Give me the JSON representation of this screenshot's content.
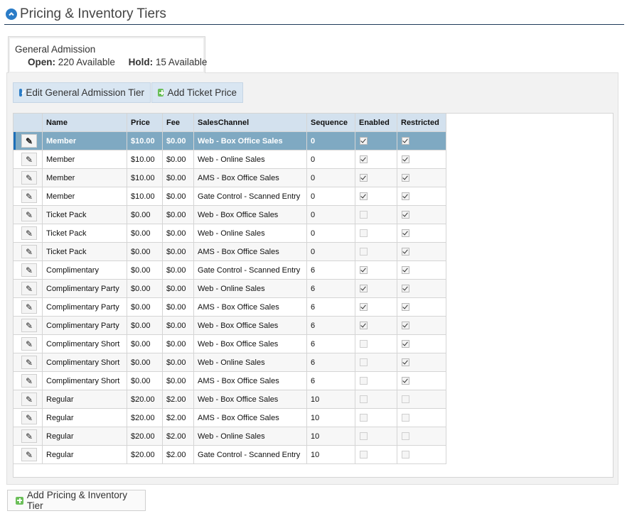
{
  "header": {
    "title": "Pricing & Inventory Tiers",
    "icon": "chevron-up-circle-icon"
  },
  "tier_tab": {
    "name": "General Admission",
    "open_label": "Open:",
    "open_value": "220 Available",
    "hold_label": "Hold:",
    "hold_value": "15 Available"
  },
  "toolbar": {
    "edit_label": "Edit General Admission Tier",
    "add_label": "Add Ticket Price"
  },
  "table": {
    "headers": [
      "Name",
      "Price",
      "Fee",
      "SalesChannel",
      "Sequence",
      "Enabled",
      "Restricted"
    ],
    "rows": [
      {
        "name": "Member",
        "price": "$10.00",
        "fee": "$0.00",
        "channel": "Web - Box Office Sales",
        "sequence": "0",
        "enabled": true,
        "restricted": true,
        "selected": true
      },
      {
        "name": "Member",
        "price": "$10.00",
        "fee": "$0.00",
        "channel": "Web - Online Sales",
        "sequence": "0",
        "enabled": true,
        "restricted": true
      },
      {
        "name": "Member",
        "price": "$10.00",
        "fee": "$0.00",
        "channel": "AMS - Box Office Sales",
        "sequence": "0",
        "enabled": true,
        "restricted": true
      },
      {
        "name": "Member",
        "price": "$10.00",
        "fee": "$0.00",
        "channel": "Gate Control - Scanned Entry",
        "sequence": "0",
        "enabled": true,
        "restricted": true
      },
      {
        "name": "Ticket Pack",
        "price": "$0.00",
        "fee": "$0.00",
        "channel": "Web - Box Office Sales",
        "sequence": "0",
        "enabled": false,
        "restricted": true
      },
      {
        "name": "Ticket Pack",
        "price": "$0.00",
        "fee": "$0.00",
        "channel": "Web - Online Sales",
        "sequence": "0",
        "enabled": false,
        "restricted": true
      },
      {
        "name": "Ticket Pack",
        "price": "$0.00",
        "fee": "$0.00",
        "channel": "AMS - Box Office Sales",
        "sequence": "0",
        "enabled": false,
        "restricted": true
      },
      {
        "name": "Complimentary",
        "price": "$0.00",
        "fee": "$0.00",
        "channel": "Gate Control - Scanned Entry",
        "sequence": "6",
        "enabled": true,
        "restricted": true
      },
      {
        "name": "Complimentary Party",
        "price": "$0.00",
        "fee": "$0.00",
        "channel": "Web - Online Sales",
        "sequence": "6",
        "enabled": true,
        "restricted": true
      },
      {
        "name": "Complimentary Party",
        "price": "$0.00",
        "fee": "$0.00",
        "channel": "AMS - Box Office Sales",
        "sequence": "6",
        "enabled": true,
        "restricted": true
      },
      {
        "name": "Complimentary Party",
        "price": "$0.00",
        "fee": "$0.00",
        "channel": "Web - Box Office Sales",
        "sequence": "6",
        "enabled": true,
        "restricted": true
      },
      {
        "name": "Complimentary Short",
        "price": "$0.00",
        "fee": "$0.00",
        "channel": "Web - Box Office Sales",
        "sequence": "6",
        "enabled": false,
        "restricted": true
      },
      {
        "name": "Complimentary Short",
        "price": "$0.00",
        "fee": "$0.00",
        "channel": "Web - Online Sales",
        "sequence": "6",
        "enabled": false,
        "restricted": true
      },
      {
        "name": "Complimentary Short",
        "price": "$0.00",
        "fee": "$0.00",
        "channel": "AMS - Box Office Sales",
        "sequence": "6",
        "enabled": false,
        "restricted": true
      },
      {
        "name": "Regular",
        "price": "$20.00",
        "fee": "$2.00",
        "channel": "Web - Box Office Sales",
        "sequence": "10",
        "enabled": false,
        "restricted": false
      },
      {
        "name": "Regular",
        "price": "$20.00",
        "fee": "$2.00",
        "channel": "AMS - Box Office Sales",
        "sequence": "10",
        "enabled": false,
        "restricted": false
      },
      {
        "name": "Regular",
        "price": "$20.00",
        "fee": "$2.00",
        "channel": "Web - Online Sales",
        "sequence": "10",
        "enabled": false,
        "restricted": false
      },
      {
        "name": "Regular",
        "price": "$20.00",
        "fee": "$2.00",
        "channel": "Gate Control - Scanned Entry",
        "sequence": "10",
        "enabled": false,
        "restricted": false
      }
    ]
  },
  "footer": {
    "add_tier_label": "Add Pricing & Inventory Tier"
  }
}
